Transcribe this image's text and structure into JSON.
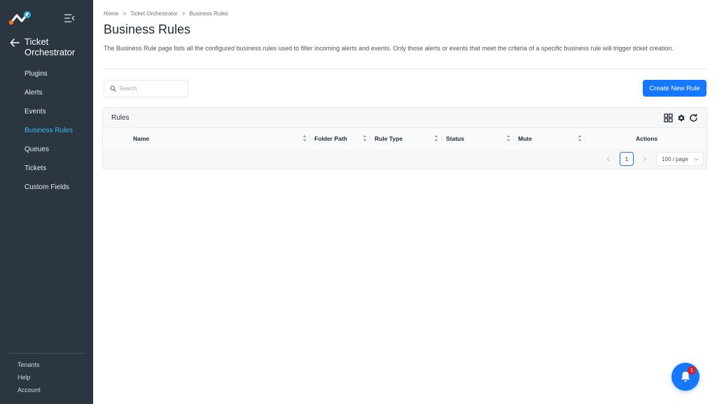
{
  "sidebar": {
    "module_title": "Ticket Orchestrator",
    "items": [
      {
        "label": "Plugins",
        "active": false
      },
      {
        "label": "Alerts",
        "active": false
      },
      {
        "label": "Events",
        "active": false
      },
      {
        "label": "Business Rules",
        "active": true
      },
      {
        "label": "Queues",
        "active": false
      },
      {
        "label": "Tickets",
        "active": false
      },
      {
        "label": "Custom Fields",
        "active": false
      }
    ],
    "footer": [
      "Tenants",
      "Help",
      "Account"
    ]
  },
  "breadcrumb": [
    "Home",
    ">",
    "Ticket Orchestrator",
    ">",
    "Business Rules"
  ],
  "page": {
    "title": "Business Rules",
    "description": "The Business Rule page lists all the configured business rules used to filter incoming alerts and events. Only those alerts or events that meet the criteria of a specific business rule will trigger ticket creation."
  },
  "search": {
    "placeholder": "Search",
    "value": ""
  },
  "toolbar": {
    "create_label": "Create New Rule"
  },
  "table": {
    "title": "Rules",
    "columns": [
      "Name",
      "Folder Path",
      "Rule Type",
      "Status",
      "Mute",
      "Actions"
    ],
    "rows": []
  },
  "pagination": {
    "current_page": "1",
    "page_size": "100 / page"
  },
  "notifications": {
    "count": "1"
  },
  "colors": {
    "sidebar_bg": "#2b3640",
    "active_nav": "#38bdf8",
    "primary": "#1677ff",
    "badge": "#e11d28"
  }
}
